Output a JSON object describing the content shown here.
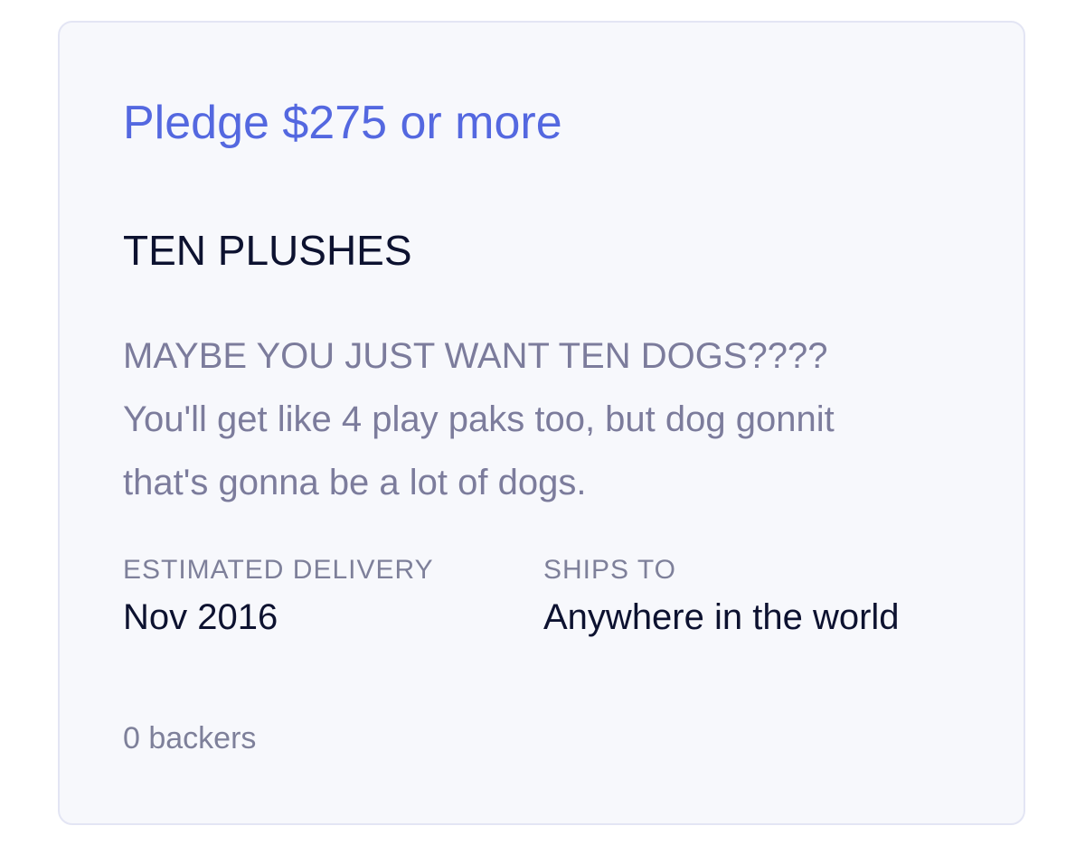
{
  "reward": {
    "pledge_label": "Pledge $275 or more",
    "title": "TEN PLUSHES",
    "description_lines": [
      "MAYBE YOU JUST WANT TEN DOGS????",
      "You'll get like 4 play paks too, but dog gonnit",
      "that's gonna be a lot of dogs."
    ],
    "estimated_delivery": {
      "label": "ESTIMATED DELIVERY",
      "value": "Nov 2016"
    },
    "ships_to": {
      "label": "SHIPS TO",
      "value": "Anywhere in the world"
    },
    "backers": "0 backers"
  },
  "colors": {
    "accent": "#5468e0",
    "card_background": "#f7f8fc",
    "card_border": "#e3e5f4",
    "title_text": "#0d1230",
    "muted_text": "#7c7c9c"
  }
}
